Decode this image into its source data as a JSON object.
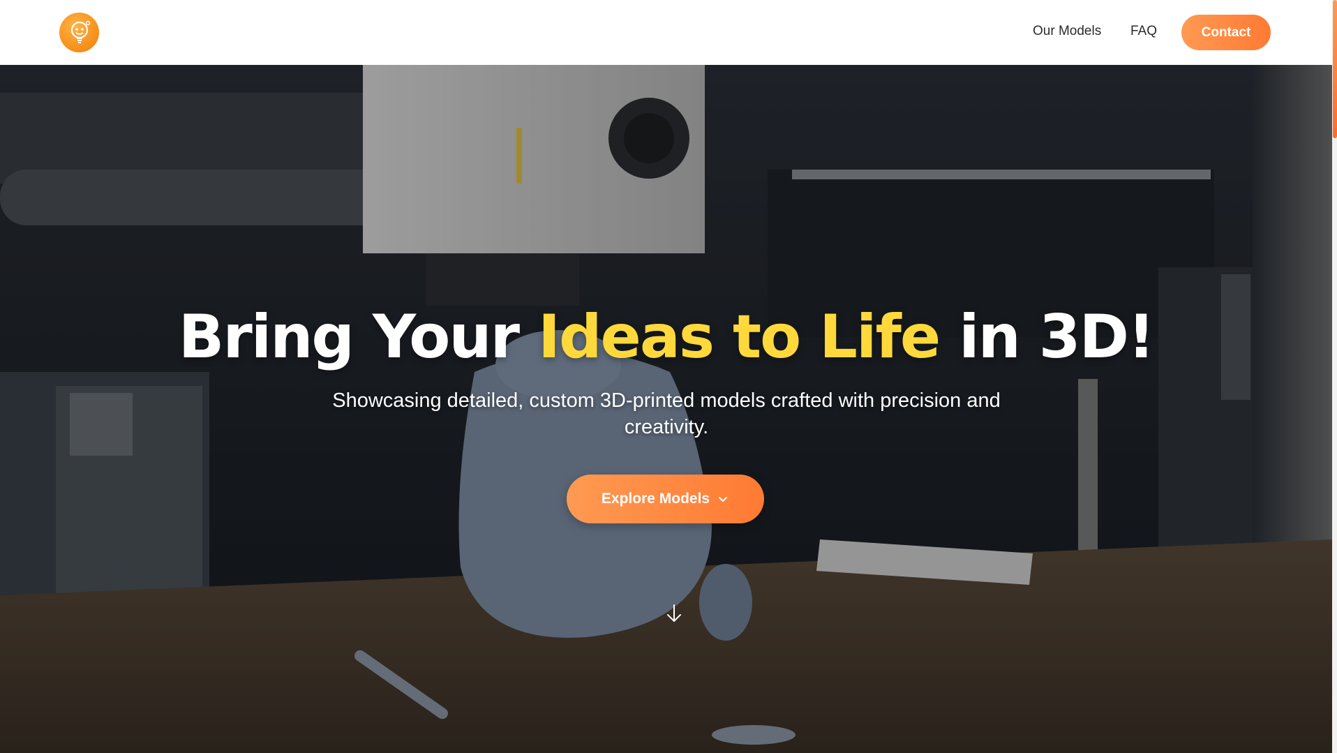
{
  "header": {
    "logo_icon": "lightbulb-face-logo-icon",
    "nav": [
      {
        "label": "Our Models"
      },
      {
        "label": "FAQ"
      }
    ],
    "contact_label": "Contact"
  },
  "hero": {
    "headline_pre": "Bring Your",
    "headline_accent": "Ideas to Life",
    "headline_post": "in 3D!",
    "subtitle": "Showcasing detailed, custom 3D-printed models crafted with precision and creativity.",
    "cta_label": "Explore Models",
    "cta_icon": "chevron-down-icon",
    "scroll_icon": "arrow-down-icon",
    "background_image": "3d-printer-interior-photo"
  },
  "colors": {
    "brand_orange": "#ff8a3d",
    "accent_yellow": "#ffd93b",
    "text_dark": "#2b2b2b"
  }
}
